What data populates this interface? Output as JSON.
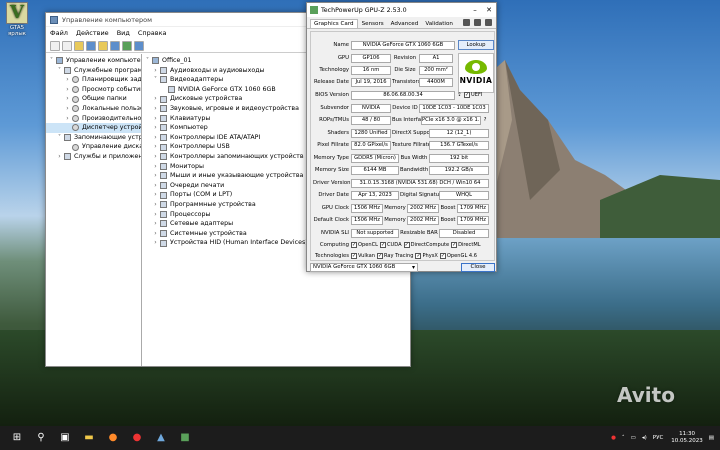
{
  "desktop_icon": {
    "line1": "GTA5",
    "line2": "ярлык"
  },
  "watermark": "Avito",
  "device_manager": {
    "title": "Управление компьютером",
    "menu": [
      "Файл",
      "Действие",
      "Вид",
      "Справка"
    ],
    "left_tree": [
      {
        "label": "Управление компьютером (л",
        "depth": 0,
        "exp": "˅"
      },
      {
        "label": "Служебные программы",
        "depth": 1,
        "exp": "˅"
      },
      {
        "label": "Планировщик заданий",
        "depth": 2,
        "exp": "›"
      },
      {
        "label": "Просмотр событий",
        "depth": 2,
        "exp": "›"
      },
      {
        "label": "Общие папки",
        "depth": 2,
        "exp": "›"
      },
      {
        "label": "Локальные пользоват",
        "depth": 2,
        "exp": "›"
      },
      {
        "label": "Производительность",
        "depth": 2,
        "exp": "›"
      },
      {
        "label": "Диспетчер устройств",
        "depth": 2,
        "exp": "",
        "selected": true
      },
      {
        "label": "Запоминающие устройств",
        "depth": 1,
        "exp": "˅"
      },
      {
        "label": "Управление дисками",
        "depth": 2,
        "exp": ""
      },
      {
        "label": "Службы и приложения",
        "depth": 1,
        "exp": "›"
      }
    ],
    "right_tree": [
      {
        "label": "Office_01",
        "depth": 0,
        "exp": "˅"
      },
      {
        "label": "Аудиовходы и аудиовыходы",
        "depth": 1,
        "exp": "›"
      },
      {
        "label": "Видеоадаптеры",
        "depth": 1,
        "exp": "˅"
      },
      {
        "label": "NVIDIA GeForce GTX 1060 6GB",
        "depth": 2,
        "exp": ""
      },
      {
        "label": "Дисковые устройства",
        "depth": 1,
        "exp": "›"
      },
      {
        "label": "Звуковые, игровые и видеоустройства",
        "depth": 1,
        "exp": "›"
      },
      {
        "label": "Клавиатуры",
        "depth": 1,
        "exp": "›"
      },
      {
        "label": "Компьютер",
        "depth": 1,
        "exp": "›"
      },
      {
        "label": "Контроллеры IDE ATA/ATAPI",
        "depth": 1,
        "exp": "›"
      },
      {
        "label": "Контроллеры USB",
        "depth": 1,
        "exp": "›"
      },
      {
        "label": "Контроллеры запоминающих устройств",
        "depth": 1,
        "exp": "›"
      },
      {
        "label": "Мониторы",
        "depth": 1,
        "exp": "›"
      },
      {
        "label": "Мыши и иные указывающие устройства",
        "depth": 1,
        "exp": "›"
      },
      {
        "label": "Очереди печати",
        "depth": 1,
        "exp": "›"
      },
      {
        "label": "Порты (COM и LPT)",
        "depth": 1,
        "exp": "›"
      },
      {
        "label": "Программные устройства",
        "depth": 1,
        "exp": "›"
      },
      {
        "label": "Процессоры",
        "depth": 1,
        "exp": "›"
      },
      {
        "label": "Сетевые адаптеры",
        "depth": 1,
        "exp": "›"
      },
      {
        "label": "Системные устройства",
        "depth": 1,
        "exp": "›"
      },
      {
        "label": "Устройства HID (Human Interface Devices)",
        "depth": 1,
        "exp": "›"
      }
    ]
  },
  "gpuz": {
    "title": "TechPowerUp GPU-Z 2.53.0",
    "tabs": [
      "Graphics Card",
      "Sensors",
      "Advanced",
      "Validation"
    ],
    "lookup": "Lookup",
    "logo_text": "NVIDIA",
    "name_label": "Name",
    "name": "NVIDIA GeForce GTX 1060 6GB",
    "gpu_label": "GPU",
    "gpu": "GP106",
    "revision_label": "Revision",
    "revision": "A1",
    "tech_label": "Technology",
    "tech": "16 nm",
    "die_label": "Die Size",
    "die": "200 mm²",
    "release_label": "Release Date",
    "release": "Jul 19, 2016",
    "transistors_label": "Transistors",
    "transistors": "4400M",
    "bios_label": "BIOS Version",
    "bios": "86.06.68.00.34",
    "uefi": "UEFI",
    "subvendor_label": "Subvendor",
    "subvendor": "NVIDIA",
    "deviceid_label": "Device ID",
    "deviceid": "10DE 1C03 - 10DE 1C03",
    "rops_label": "ROPs/TMUs",
    "rops": "48 / 80",
    "bus_label": "Bus Interface",
    "bus": "PCIe x16 3.0 @ x16 1.1",
    "q": "?",
    "shaders_label": "Shaders",
    "shaders": "1280 Unified",
    "dx_label": "DirectX Support",
    "dx": "12 (12_1)",
    "pixel_label": "Pixel Fillrate",
    "pixel": "82.0 GPixel/s",
    "texture_label": "Texture Fillrate",
    "texture": "136.7 GTexel/s",
    "memtype_label": "Memory Type",
    "memtype": "GDDR5 (Micron)",
    "buswidth_label": "Bus Width",
    "buswidth": "192 bit",
    "memsize_label": "Memory Size",
    "memsize": "6144 MB",
    "bandwidth_label": "Bandwidth",
    "bandwidth": "192.2 GB/s",
    "driver_label": "Driver Version",
    "driver": "31.0.15.3168 (NVIDIA 531.68) DCH / Win10 64",
    "driverdate_label": "Driver Date",
    "driverdate": "Apr 13, 2023",
    "sig_label": "Digital Signature",
    "sig": "WHQL",
    "gpuclock_label": "GPU Clock",
    "gpuclock": "1506 MHz",
    "mem1_label": "Memory",
    "mem1": "2002 MHz",
    "boost1_label": "Boost",
    "boost1": "1709 MHz",
    "defclock_label": "Default Clock",
    "defclock": "1506 MHz",
    "mem2_label": "Memory",
    "mem2": "2002 MHz",
    "boost2_label": "Boost",
    "boost2": "1709 MHz",
    "sli_label": "NVIDIA SLI",
    "sli": "Not supported",
    "rebar_label": "Resizable BAR",
    "rebar": "Disabled",
    "computing_label": "Computing",
    "computing": [
      "OpenCL",
      "CUDA",
      "DirectCompute",
      "DirectML"
    ],
    "technologies_label": "Technologies",
    "technologies": [
      "Vulkan",
      "Ray Tracing",
      "PhysX",
      "OpenGL 4.6"
    ],
    "dropdown": "NVIDIA GeForce GTX 1060 6GB",
    "close": "Close"
  },
  "taskbar": {
    "lang": "РУС",
    "time": "11:30",
    "date": "10.05.2023"
  }
}
